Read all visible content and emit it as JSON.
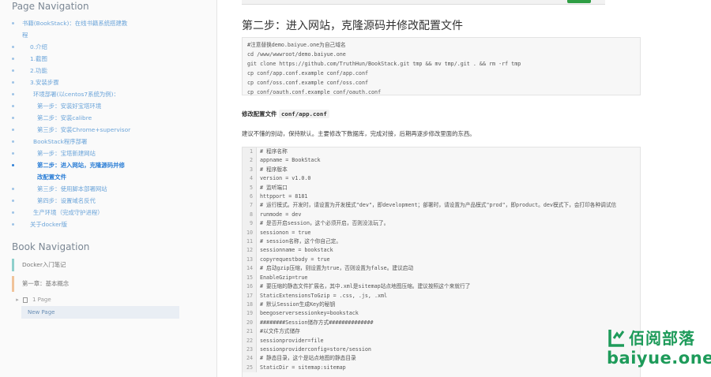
{
  "sidebar": {
    "page_nav_title": "Page Navigation",
    "toc": [
      {
        "label": "书籍(BookStack)：在线书籍系统搭建教",
        "indent": 28,
        "active": false
      },
      {
        "label": "程",
        "indent": 28,
        "active": false
      },
      {
        "label": "0.介绍",
        "indent": 38,
        "active": false
      },
      {
        "label": "1.截图",
        "indent": 38,
        "active": false
      },
      {
        "label": "2.功能",
        "indent": 38,
        "active": false
      },
      {
        "label": "3.安装步骤",
        "indent": 38,
        "active": false
      },
      {
        "label": "环境部署(以centos7系统为例)：",
        "indent": 42,
        "active": false
      },
      {
        "label": "第一步：安装好宝塔环境",
        "indent": 47,
        "active": false
      },
      {
        "label": "第二步：安装calibre",
        "indent": 47,
        "active": false
      },
      {
        "label": "第三步：安装Chrome+supervisor",
        "indent": 47,
        "active": false
      },
      {
        "label": "BookStack程序部署",
        "indent": 42,
        "active": false
      },
      {
        "label": "第一步：宝塔新建网站",
        "indent": 47,
        "active": false
      },
      {
        "label": "第二步：进入网站，克隆源码并修",
        "indent": 47,
        "active": true
      },
      {
        "label": "改配置文件",
        "indent": 47,
        "active": true
      },
      {
        "label": "第三步：使用脚本部署网站",
        "indent": 47,
        "active": false
      },
      {
        "label": "第四步：设置域名反代",
        "indent": 47,
        "active": false
      },
      {
        "label": "生产环境（完成守护进程）",
        "indent": 42,
        "active": false
      },
      {
        "label": "关于docker版",
        "indent": 38,
        "active": false
      }
    ],
    "book_nav_title": "Book Navigation",
    "book_nav": {
      "book": "Docker入门笔记",
      "chapter": "第一章：基本概念",
      "page": "1 Page",
      "new_page": "New Page"
    }
  },
  "main": {
    "step_title": "第二步：进入网站，克隆源码并修改配置文件",
    "code1": [
      "#注意替换demo.baiyue.one为自己域名",
      "cd /www/wwwroot/demo.baiyue.one",
      "git clone https://github.com/TruthHun/BookStack.git tmp && mv tmp/.git . && rm -rf tmp",
      "cp conf/app.conf.example conf/app.conf",
      "cp conf/oss.conf.example conf/oss.conf",
      "cp conf/oauth.conf.example conf/oauth.conf"
    ],
    "config_label": "修改配置文件",
    "config_file": "conf/app.conf",
    "config_desc": "建议不懂的别动，保持默认。主要修改下数据库，完成对接，后期再逐步修改里面的东西。",
    "code2": [
      {
        "n": "1",
        "t": "# 程序名称"
      },
      {
        "n": "2",
        "t": "appname = BookStack"
      },
      {
        "n": "3",
        "t": "# 程序版本"
      },
      {
        "n": "4",
        "t": "version = v1.0.0"
      },
      {
        "n": "5",
        "t": "# 监听端口"
      },
      {
        "n": "6",
        "t": "httpport = 8181"
      },
      {
        "n": "7",
        "t": "# 运行模式。开发时，请设置为开发模式\"dev\"，即development；部署时，请设置为产品模式\"prod\"，即product。dev模式下，会打印各种调试信"
      },
      {
        "n": "8",
        "t": "runmode = dev"
      },
      {
        "n": "9",
        "t": "# 是否开启session，这个必须开启，否则没法玩了。"
      },
      {
        "n": "10",
        "t": "sessionon = true"
      },
      {
        "n": "11",
        "t": "# session名称，这个你自己定。"
      },
      {
        "n": "12",
        "t": "sessionname = bookstack"
      },
      {
        "n": "13",
        "t": "copyrequestbody = true"
      },
      {
        "n": "14",
        "t": "# 启动gzip压缩，则设置为true，否则设置为false。建议启动"
      },
      {
        "n": "15",
        "t": "EnableGzip=true"
      },
      {
        "n": "16",
        "t": "# 要压缩的静态文件扩展名，其中.xml是sitemap站点地图压缩。建议按照这个来就行了"
      },
      {
        "n": "17",
        "t": "StaticExtensionsToGzip = .css, .js, .xml"
      },
      {
        "n": "18",
        "t": "# 默认Session生成Key的秘钥"
      },
      {
        "n": "19",
        "t": "beegoserversessionkey=bookstack"
      },
      {
        "n": "20",
        "t": "########Session储存方式##############"
      },
      {
        "n": "21",
        "t": "#以文件方式储存"
      },
      {
        "n": "22",
        "t": "sessionprovider=file"
      },
      {
        "n": "23",
        "t": "sessionproviderconfig=store/session"
      },
      {
        "n": "24",
        "t": "# 静态目录，这个是站点地图的静态目录"
      },
      {
        "n": "25",
        "t": "StaticDir = sitemap:sitemap"
      }
    ]
  },
  "watermark": {
    "name": "佰阅部落",
    "url": "baiyue.one"
  },
  "colors": {
    "link": "#6ba4d9",
    "active": "#2d7fd6",
    "brand_green": "#1e9b5a"
  }
}
